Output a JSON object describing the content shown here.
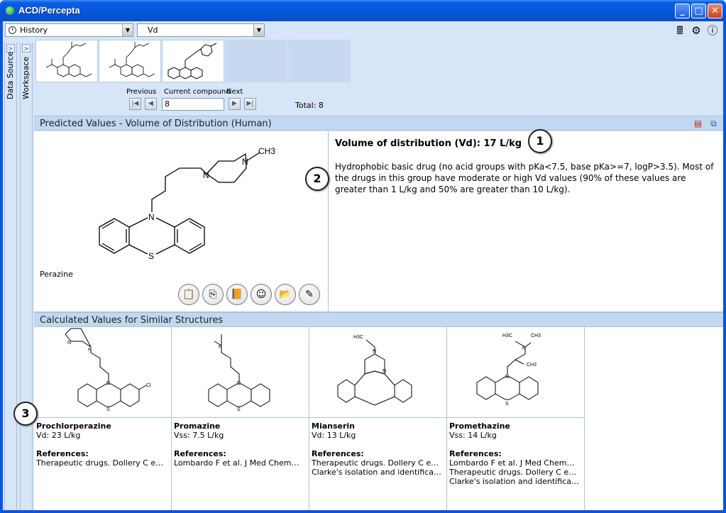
{
  "window": {
    "title": "ACD/Percepta"
  },
  "toolbar": {
    "history_combo": "History",
    "module_combo": "Vd"
  },
  "sidebar": {
    "tabs": [
      "Data Source",
      "Workspace"
    ]
  },
  "navigator": {
    "previous_label": "Previous",
    "current_label": "Current compound",
    "next_label": "Next",
    "current_value": "8",
    "total": "Total: 8"
  },
  "predicted": {
    "header": "Predicted Values - Volume of Distribution (Human)",
    "compound_name": "Perazine",
    "vd_title": "Volume of distribution (Vd): 17 L/kg",
    "description": "Hydrophobic basic drug (no acid groups with pKa<7.5, base pKa>=7, logP>3.5). Most of the drugs in this group have moderate or high Vd values (90% of these values are greater than 1 L/kg and 50% are greater than 10 L/kg)."
  },
  "callouts": [
    "1",
    "2",
    "3"
  ],
  "similar": {
    "header": "Calculated Values for Similar Structures",
    "references_label": "References:",
    "cards": [
      {
        "name": "Prochlorperazine",
        "value": "Vd: 23 L/kg",
        "refs": [
          "Therapeutic drugs. Dollery C e…"
        ]
      },
      {
        "name": "Promazine",
        "value": "Vss: 7.5 L/kg",
        "refs": [
          "Lombardo F et al. J Med Chem…"
        ]
      },
      {
        "name": "Mianserin",
        "value": "Vd: 13 L/kg",
        "refs": [
          "Therapeutic drugs. Dollery C e…",
          "Clarke's isolation and identifica…"
        ]
      },
      {
        "name": "Promethazine",
        "value": "Vss: 14 L/kg",
        "refs": [
          "Lombardo F et al. J Med Chem…",
          "Therapeutic drugs. Dollery C e…",
          "Clarke's isolation and identifica…"
        ]
      }
    ]
  },
  "structure_labels": {
    "n": "N",
    "s": "S",
    "methyl": "CH3",
    "h3c": "H3C",
    "cl": "Cl"
  },
  "icons": {
    "app": "app-icon",
    "minimize": "minimize-icon",
    "maximize": "maximize-icon",
    "close": "close-icon",
    "calculator": "calculator-icon",
    "settings": "gear-icon",
    "info": "info-icon",
    "pdf": "pdf-icon",
    "copy": "copy-icon"
  },
  "colors": {
    "titlebar": "#0754d8",
    "panel": "#d6e5f7",
    "header": "#c1d8f0"
  }
}
